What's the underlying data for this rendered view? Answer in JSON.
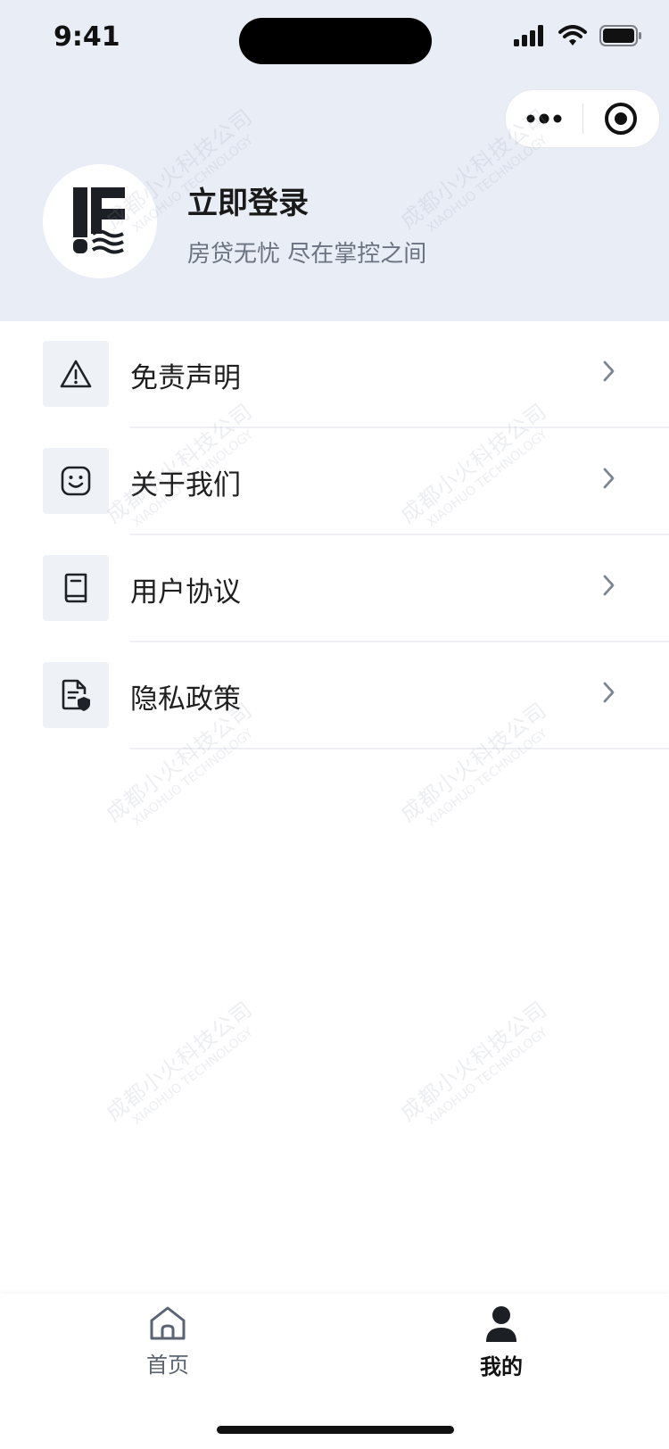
{
  "status_bar": {
    "time": "9:41"
  },
  "profile": {
    "title": "立即登录",
    "subtitle": "房贷无忧 尽在掌控之间"
  },
  "menu": {
    "items": [
      {
        "label": "免责声明",
        "icon": "warning-icon"
      },
      {
        "label": "关于我们",
        "icon": "smile-icon"
      },
      {
        "label": "用户协议",
        "icon": "book-icon"
      },
      {
        "label": "隐私政策",
        "icon": "document-shield-icon"
      }
    ]
  },
  "tabbar": {
    "items": [
      {
        "label": "首页",
        "icon": "home-icon",
        "active": false
      },
      {
        "label": "我的",
        "icon": "person-icon",
        "active": true
      }
    ]
  },
  "watermark": {
    "cn": "成都小火科技公司",
    "en": "XIAOHUO TECHNOLOGY"
  },
  "colors": {
    "header_bg": "#e9edf6",
    "icon_box_bg": "#eef1f5",
    "active_tab": "#111111",
    "inactive_tab": "#5b6472"
  }
}
